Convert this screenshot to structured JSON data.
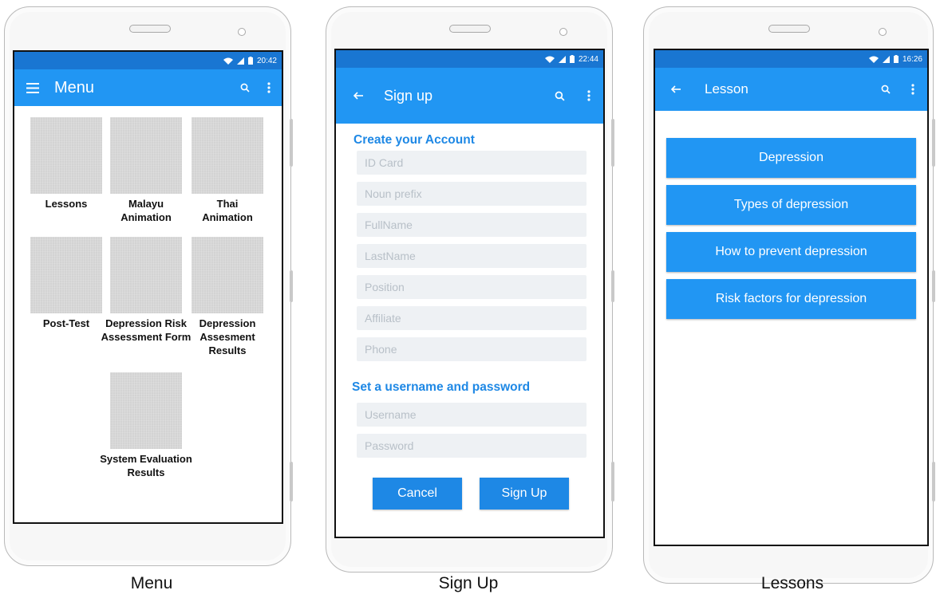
{
  "menu_phone": {
    "status_time": "20:42",
    "title": "Menu",
    "tiles": [
      "Lessons",
      "Malayu Animation",
      "Thai Animation",
      "Post-Test",
      "Depression Risk Assessment Form",
      "Depression Assesment Results",
      "System Evaluation Results"
    ],
    "caption": "Menu"
  },
  "signup_phone": {
    "status_time": "22:44",
    "title": "Sign up",
    "section_account": "Create your Account",
    "fields": [
      "ID Card",
      "Noun prefix",
      "FullName",
      "LastName",
      "Position",
      "Affiliate",
      "Phone"
    ],
    "section_credentials": "Set a username and password",
    "username_placeholder": "Username",
    "password_placeholder": "Password",
    "cancel_label": "Cancel",
    "signup_label": "Sign Up",
    "caption": "Sign Up"
  },
  "lesson_phone": {
    "status_time": "16:26",
    "title": "Lesson",
    "items": [
      "Depression",
      "Types of depression",
      "How to prevent depression",
      "Risk factors for depression"
    ],
    "caption": "Lessons"
  },
  "colors": {
    "appbar": "#2196f3",
    "statusbar": "#1976d2",
    "accent_text": "#1e88e5"
  },
  "icons": [
    "hamburger-icon",
    "back-arrow-icon",
    "search-icon",
    "overflow-menu-icon",
    "wifi-icon",
    "signal-icon",
    "battery-icon"
  ]
}
